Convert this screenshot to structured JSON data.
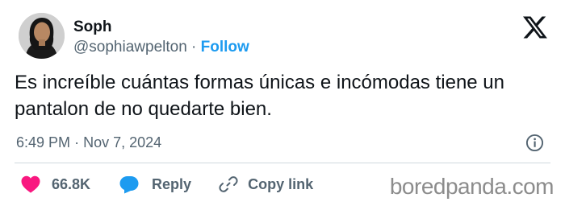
{
  "author": {
    "name": "Soph",
    "handle": "@sophiawpelton",
    "separator": "·",
    "follow_label": "Follow"
  },
  "platform_logo_icon": "x-logo-icon",
  "tweet": {
    "text": "Es increíble cuántas formas únicas e incómodas tiene un pantalon de no quedarte bien.",
    "time": "6:49 PM",
    "separator": "·",
    "date": "Nov 7, 2024"
  },
  "actions": {
    "likes": "66.8K",
    "reply_label": "Reply",
    "copy_link_label": "Copy link"
  },
  "watermark": "boredpanda.com",
  "colors": {
    "follow": "#1d9bf0",
    "like_heart": "#f91880",
    "reply_bubble": "#1d9bf0",
    "secondary_text": "#536471"
  }
}
